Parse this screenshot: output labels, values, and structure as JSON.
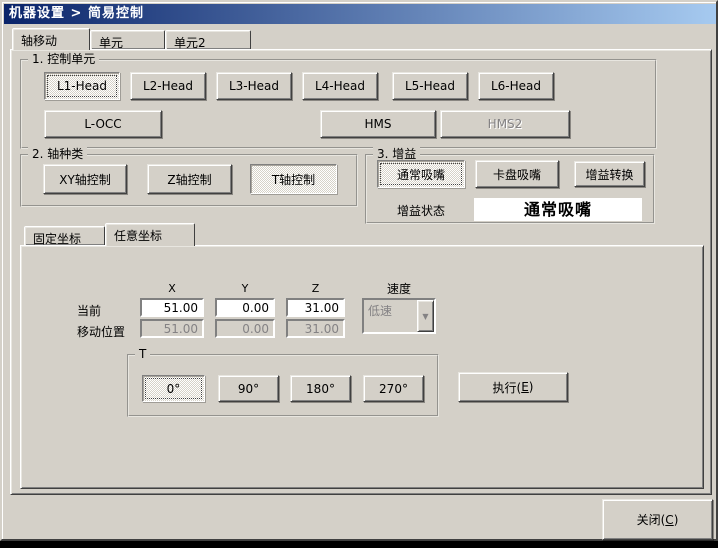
{
  "titlebar": {
    "title": "机器设置 > 简易控制"
  },
  "main_tabs": {
    "tab1": "轴移动",
    "tab2": "单元",
    "tab3": "单元2"
  },
  "control_unit": {
    "title": "1. 控制单元",
    "l1": "L1-Head",
    "l2": "L2-Head",
    "l3": "L3-Head",
    "l4": "L4-Head",
    "l5": "L5-Head",
    "l6": "L6-Head",
    "locc": "L-OCC",
    "hms": "HMS",
    "hms2": "HMS2"
  },
  "axis_type": {
    "title": "2. 轴种类",
    "xy": "XY轴控制",
    "z": "Z轴控制",
    "t": "T轴控制"
  },
  "gain": {
    "title": "3. 增益",
    "normal": "通常吸嘴",
    "chuck": "卡盘吸嘴",
    "convert": "增益转换",
    "status_label": "增益状态",
    "status_value": "通常吸嘴"
  },
  "coord_tabs": {
    "fixed": "固定坐标",
    "arbitrary": "任意坐标"
  },
  "coords": {
    "col_x": "X",
    "col_y": "Y",
    "col_z": "Z",
    "speed_label": "速度",
    "current_label": "当前",
    "move_label": "移动位置",
    "current": {
      "x": "51.00",
      "y": "0.00",
      "z": "31.00"
    },
    "move": {
      "x": "51.00",
      "y": "0.00",
      "z": "31.00"
    },
    "speed_value": "低速"
  },
  "t_group": {
    "title": "T",
    "deg0": "0°",
    "deg90": "90°",
    "deg180": "180°",
    "deg270": "270°"
  },
  "execute": {
    "pre": "执行(",
    "key": "E",
    "post": ")"
  },
  "close": {
    "pre": "关闭(",
    "key": "C",
    "post": ")"
  },
  "colors": {
    "titlebar_left": "#0a246a",
    "titlebar_right": "#a6caf0",
    "face": "#d4d0c8",
    "status_bg": "#ffffff"
  }
}
